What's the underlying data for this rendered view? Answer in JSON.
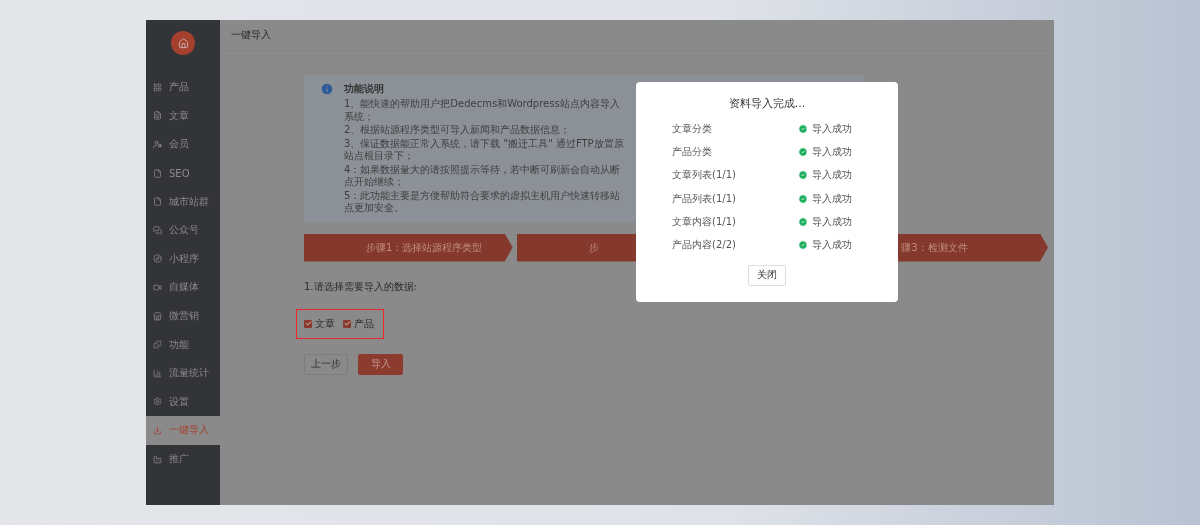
{
  "sidebar": {
    "items": [
      {
        "label": "产品",
        "selected": false
      },
      {
        "label": "文章",
        "selected": false
      },
      {
        "label": "会员",
        "selected": false
      },
      {
        "label": "SEO",
        "selected": false
      },
      {
        "label": "城市站群",
        "selected": false
      },
      {
        "label": "公众号",
        "selected": false
      },
      {
        "label": "小程序",
        "selected": false
      },
      {
        "label": "自媒体",
        "selected": false
      },
      {
        "label": "微营销",
        "selected": false
      },
      {
        "label": "功能",
        "selected": false
      },
      {
        "label": "流量统计",
        "selected": false
      },
      {
        "label": "设置",
        "selected": false
      },
      {
        "label": "一键导入",
        "selected": true
      },
      {
        "label": "推广",
        "selected": false
      }
    ]
  },
  "header": {
    "title": "一键导入"
  },
  "info": {
    "title": "功能说明",
    "lines": [
      "1、能快速的帮助用户把Dedecms和Wordpress站点内容导入系统；",
      "2、根据站源程序类型可导入新闻和产品数据信息；",
      "3、保证数据能正常入系统，请下载 \"搬迁工具\" 通过FTP放置原站点根目录下；",
      "4：如果数据量大的请按照提示等待，若中断可刷新会自动从断点开始继续；",
      "5：此功能主要是方便帮助符合要求的虚拟主机用户快速转移站点更加安全。"
    ]
  },
  "steps": [
    {
      "label": "步骤1：选择站源程序类型"
    },
    {
      "label": "步"
    },
    {
      "label": "骤3：检测文件"
    }
  ],
  "select": {
    "question": "1.请选择需要导入的数据:",
    "options": [
      {
        "label": "文章",
        "checked": true
      },
      {
        "label": "产品",
        "checked": true
      }
    ]
  },
  "buttons": {
    "back": "上一步",
    "import": "导入"
  },
  "modal": {
    "title": "资料导入完成...",
    "rows": [
      {
        "item": "文章分类",
        "status": "导入成功"
      },
      {
        "item": "产品分类",
        "status": "导入成功"
      },
      {
        "item": "文章列表(1/1)",
        "status": "导入成功"
      },
      {
        "item": "产品列表(1/1)",
        "status": "导入成功"
      },
      {
        "item": "文章内容(1/1)",
        "status": "导入成功"
      },
      {
        "item": "产品内容(2/2)",
        "status": "导入成功"
      }
    ],
    "close": "关闭"
  }
}
